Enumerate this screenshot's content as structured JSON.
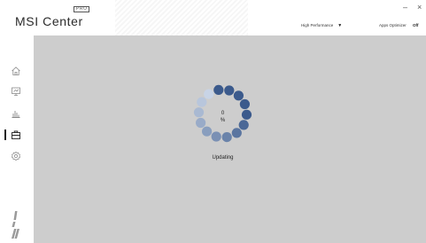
{
  "app": {
    "logo_text": "MSI Center",
    "pro_badge": "PRO"
  },
  "header": {
    "profile_select": "High Performance",
    "apps_optimizer_label": "Apps Optimizer",
    "apps_optimizer_state": "Off",
    "minimize_glyph": "–",
    "close_glyph": "×"
  },
  "sidebar": {
    "items": [
      {
        "name": "home",
        "icon": "home-icon"
      },
      {
        "name": "features",
        "icon": "monitor-icon"
      },
      {
        "name": "performance",
        "icon": "bar-chart-icon"
      },
      {
        "name": "support",
        "icon": "toolbox-icon",
        "active": true
      },
      {
        "name": "settings",
        "icon": "gear-icon"
      }
    ],
    "brand_mark": "msi"
  },
  "main": {
    "progress_value": "0",
    "progress_unit": "%",
    "progress_percent": 0,
    "status": "Updating"
  },
  "colors": {
    "accent_dark": "#3a5a8c",
    "content_bg": "#cdcdcd",
    "dot_light": "#c2cfe2"
  }
}
